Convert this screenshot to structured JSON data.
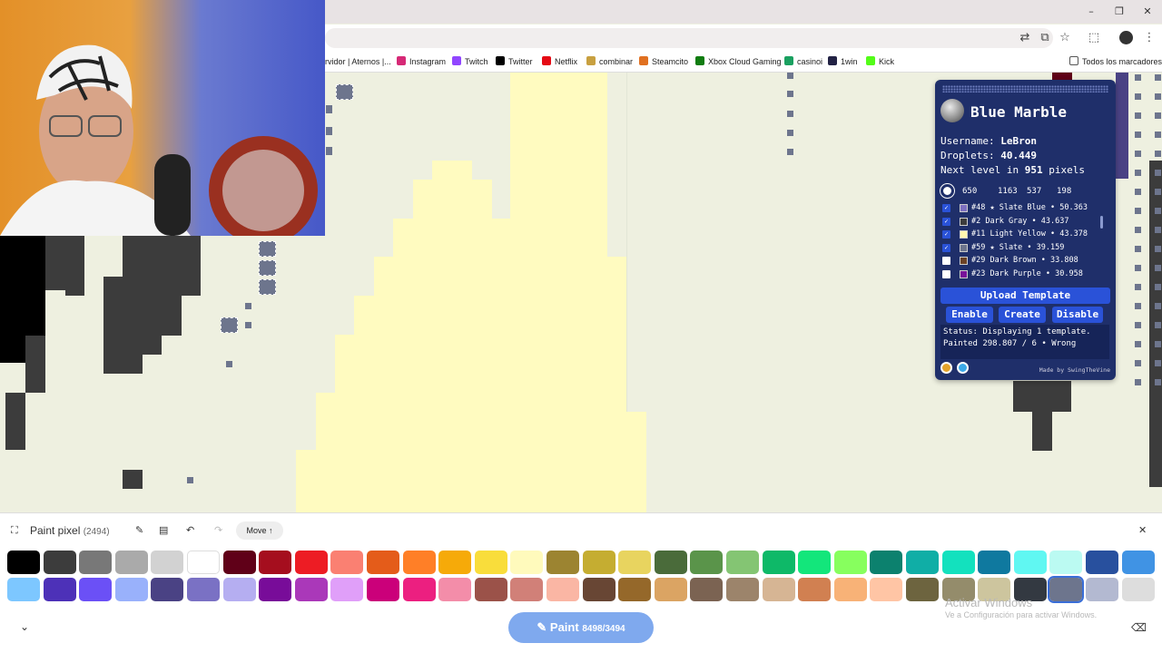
{
  "bookmarks": [
    {
      "label": "rvidor | Aternos |...",
      "color": "#f0f0f0"
    },
    {
      "label": "Instagram",
      "color": "#d62976"
    },
    {
      "label": "Twitch",
      "color": "#9146ff"
    },
    {
      "label": "Twitter",
      "color": "#000000"
    },
    {
      "label": "Netflix",
      "color": "#e50914"
    },
    {
      "label": "combinar",
      "color": "#c8a040"
    },
    {
      "label": "Steamcito",
      "color": "#e07020"
    },
    {
      "label": "Xbox Cloud Gaming",
      "color": "#107c10"
    },
    {
      "label": "casinoi",
      "color": "#1aa060"
    },
    {
      "label": "1win",
      "color": "#222244"
    },
    {
      "label": "Kick",
      "color": "#53fc18"
    }
  ],
  "bookmarks_folder": "Todos los marcadores",
  "panel": {
    "title": "Blue Marble",
    "username_label": "Username:",
    "username": "LeBron",
    "droplets_label": "Droplets:",
    "droplets": "40.449",
    "level_prefix": "Next level in",
    "level_pixels": "951",
    "level_suffix": "pixels",
    "coords": [
      "650",
      "1163",
      "537",
      "198"
    ],
    "templates": [
      {
        "text": "#48 ★ Slate Blue • 50.363",
        "checked": true,
        "color": "#7d6fc0"
      },
      {
        "text": "#2 Dark Gray • 43.637",
        "checked": true,
        "color": "#3c3c3c"
      },
      {
        "text": "#11 Light Yellow • 43.378",
        "checked": true,
        "color": "#fff8b0"
      },
      {
        "text": "#59 ★ Slate • 39.159",
        "checked": true,
        "color": "#6d758d"
      },
      {
        "text": "#29 Dark Brown • 33.808",
        "checked": false,
        "color": "#6b4226"
      },
      {
        "text": "#23 Dark Purple • 30.958",
        "checked": false,
        "color": "#78129a"
      }
    ],
    "upload_label": "Upload Template",
    "enable_label": "Enable",
    "create_label": "Create",
    "disable_label": "Disable",
    "status_text": "Status: Displaying 1 template. Painted 298.807 / 6 • Wrong",
    "made_by": "Made by SwingTheVine"
  },
  "toolbar": {
    "paint_pixel_label": "Paint pixel",
    "paint_pixel_count": "(2494)",
    "move_label": "Move ↑"
  },
  "paint_button": {
    "label": "Paint",
    "count": "8498/3494"
  },
  "watermark": {
    "line1": "Activar Windows",
    "line2": "Ve a Configuración para activar Windows."
  },
  "palette_row1": [
    "#000000",
    "#3c3c3c",
    "#787878",
    "#aaaaaa",
    "#d2d2d2",
    "#ffffff",
    "#600018",
    "#a50e1e",
    "#ed1c24",
    "#fa8072",
    "#e45c1a",
    "#ff7f27",
    "#f6aa09",
    "#f9dd3b",
    "#fffabc",
    "#9c8431",
    "#c5ad31",
    "#e8d45f",
    "#4a6b3a",
    "#5a944a",
    "#84c573",
    "#0eb968",
    "#13e67b",
    "#87ff5e",
    "#0c816e",
    "#10aea6",
    "#13e1be",
    "#0f799f",
    "#60f7f2",
    "#bbfaf2",
    "#28509e",
    "#4093e4"
  ],
  "palette_row2": [
    "#7dc7ff",
    "#4d31b8",
    "#6b50f6",
    "#99b1fb",
    "#4a4284",
    "#7a71c4",
    "#b5aef1",
    "#780c99",
    "#aa38b9",
    "#e09ff9",
    "#cb007a",
    "#ec1f80",
    "#f38da9",
    "#9b5249",
    "#d18078",
    "#fab6a4",
    "#684634",
    "#95682a",
    "#dba463",
    "#7b6352",
    "#9c846b",
    "#d6b594",
    "#d18051",
    "#f8b277",
    "#ffc5a5",
    "#6d643f",
    "#948c6b",
    "#cdc59e",
    "#333941",
    "#6d758d",
    "#b3b9d1",
    "#dddddd"
  ],
  "colors": {
    "panel_bg": "#1f2f6a",
    "panel_button": "#2a52d8",
    "paint_button": "#7fa9ee",
    "canvas_bg": "#eef0e0",
    "light_yellow": "#fff8b0"
  }
}
